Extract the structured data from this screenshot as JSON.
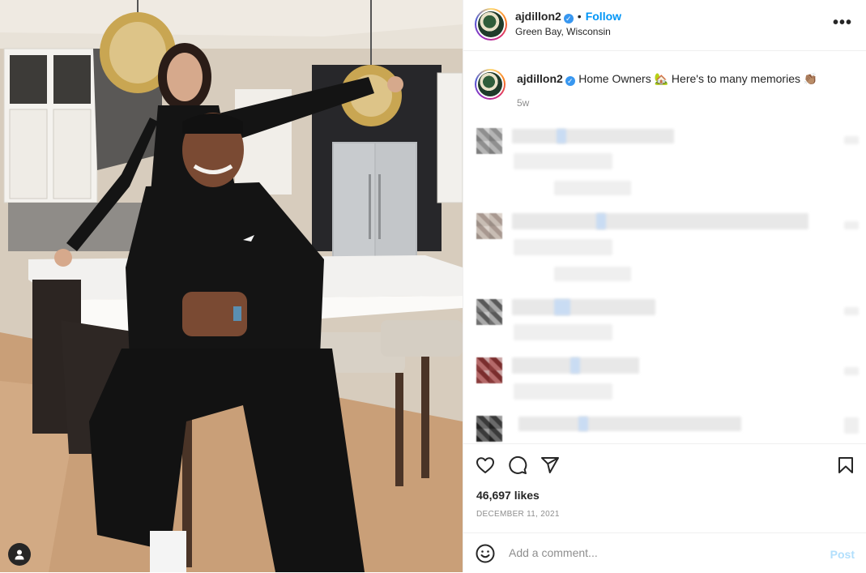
{
  "post": {
    "username": "ajdillon2",
    "verified_mark": "✓",
    "separator": "•",
    "follow_label": "Follow",
    "location": "Green Bay, Wisconsin",
    "more_label": "•••"
  },
  "caption": {
    "username": "ajdillon2",
    "text": "Home Owners 🏡 Here's to many memories 👏🏽",
    "time_ago": "5w"
  },
  "actions": {
    "likes": "46,697 likes",
    "date": "DECEMBER 11, 2021",
    "icons": [
      "heart-icon",
      "comment-icon",
      "share-icon",
      "bookmark-icon"
    ]
  },
  "add_comment": {
    "placeholder": "Add a comment...",
    "post_label": "Post",
    "emoji_icon": "smiley-icon"
  },
  "colors": {
    "link_blue": "#0095f6",
    "verified_blue": "#3897f0",
    "post_disabled": "#b2dffc",
    "muted": "#8e8e8e",
    "border": "#efefef"
  }
}
